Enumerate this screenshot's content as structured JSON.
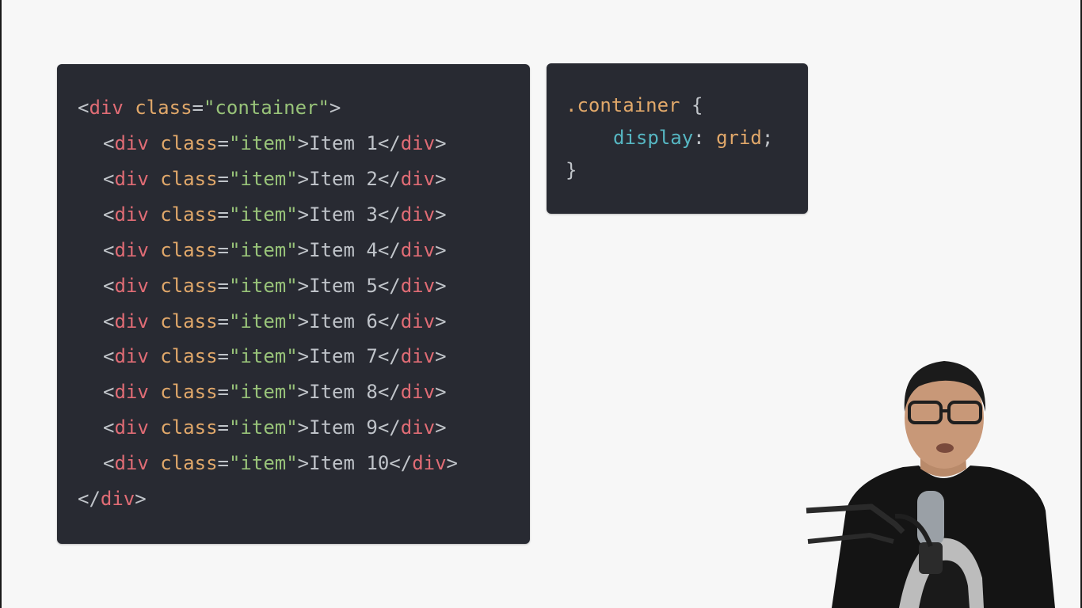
{
  "html_code": {
    "open": {
      "tag": "div",
      "attr": "class",
      "value": "\"container\""
    },
    "items": [
      {
        "label": "Item 1"
      },
      {
        "label": "Item 2"
      },
      {
        "label": "Item 3"
      },
      {
        "label": "Item 4"
      },
      {
        "label": "Item 5"
      },
      {
        "label": "Item 6"
      },
      {
        "label": "Item 7"
      },
      {
        "label": "Item 8"
      },
      {
        "label": "Item 9"
      },
      {
        "label": "Item 10"
      }
    ],
    "item_tag": "div",
    "item_attr": "class",
    "item_value": "\"item\"",
    "close_tag": "div"
  },
  "css_code": {
    "selector": ".container",
    "open_brace": "{",
    "property": "display",
    "value": "grid",
    "close_brace": "}"
  },
  "colors": {
    "panel_background": "#282a32",
    "page_background": "#f7f7f7",
    "tag": "#e06c75",
    "attribute": "#e1a86a",
    "string": "#98c379",
    "property": "#56b6c2",
    "text": "#bfc3c9"
  }
}
